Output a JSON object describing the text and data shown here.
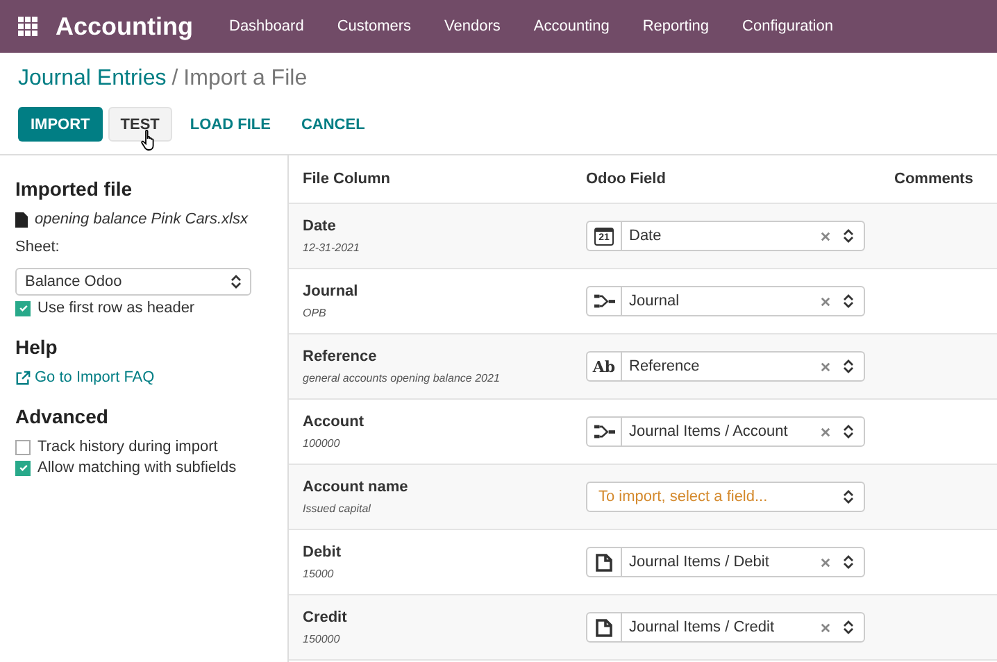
{
  "navbar": {
    "app_name": "Accounting",
    "menu": [
      "Dashboard",
      "Customers",
      "Vendors",
      "Accounting",
      "Reporting",
      "Configuration"
    ]
  },
  "breadcrumb": {
    "parent": "Journal Entries",
    "separator": "/",
    "current": "Import a File"
  },
  "actions": [
    {
      "label": "IMPORT",
      "kind": "primary"
    },
    {
      "label": "TEST",
      "kind": "secondary"
    },
    {
      "label": "LOAD FILE",
      "kind": "link"
    },
    {
      "label": "CANCEL",
      "kind": "link"
    }
  ],
  "sidebar": {
    "imported_file": {
      "heading": "Imported file",
      "file_name": "opening balance Pink Cars.xlsx",
      "sheet_label": "Sheet:",
      "sheet_value": "Balance Odoo"
    },
    "header_option": {
      "label": "Use first row as header",
      "checked": true
    },
    "help": {
      "heading": "Help",
      "link": "Go to Import FAQ"
    },
    "advanced": {
      "heading": "Advanced",
      "options": [
        {
          "label": "Track history during import",
          "checked": false
        },
        {
          "label": "Allow matching with subfields",
          "checked": true
        }
      ]
    }
  },
  "table": {
    "columns": [
      "File Column",
      "Odoo Field",
      "Comments"
    ],
    "rows": [
      {
        "name": "Date",
        "sample": "12-31-2021",
        "field": {
          "kind": "date",
          "icon_label": "21",
          "value": "Date"
        }
      },
      {
        "name": "Journal",
        "sample": "OPB",
        "field": {
          "kind": "relation",
          "value": "Journal"
        }
      },
      {
        "name": "Reference",
        "sample": "general accounts opening balance 2021",
        "field": {
          "kind": "text",
          "icon_label": "Ab",
          "value": "Reference"
        }
      },
      {
        "name": "Account",
        "sample": "100000",
        "field": {
          "kind": "relation",
          "value": "Journal Items / Account"
        }
      },
      {
        "name": "Account name",
        "sample": "Issued capital",
        "field": {
          "kind": "none",
          "placeholder": "To import, select a field..."
        }
      },
      {
        "name": "Debit",
        "sample": "15000",
        "field": {
          "kind": "number",
          "value": "Journal Items / Debit"
        }
      },
      {
        "name": "Credit",
        "sample": "150000",
        "field": {
          "kind": "number",
          "value": "Journal Items / Credit"
        }
      }
    ]
  }
}
